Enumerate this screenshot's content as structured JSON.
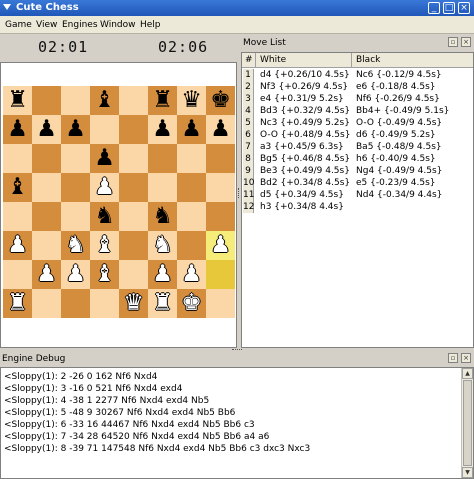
{
  "window": {
    "title": "Cute Chess",
    "buttons": {
      "minimize": "_",
      "maximize": "□",
      "close": "×"
    }
  },
  "menu": [
    "Game",
    "View",
    "Engines",
    "Window",
    "Help"
  ],
  "clocks": {
    "white": "02:01",
    "black": "02:06"
  },
  "board": {
    "ranks": [
      [
        "r",
        "",
        "",
        "b",
        "",
        "r",
        "q",
        "k"
      ],
      [
        "p",
        "p",
        "p",
        "",
        "",
        "p",
        "p",
        "p"
      ],
      [
        "",
        "",
        "",
        "p",
        "",
        "",
        "",
        ""
      ],
      [
        "b",
        "",
        "",
        "P",
        "",
        "",
        "",
        ""
      ],
      [
        "",
        "",
        "",
        "n",
        "",
        "n",
        "",
        ""
      ],
      [
        "P",
        "",
        "N",
        "B",
        "",
        "N",
        "",
        "P"
      ],
      [
        "",
        "P",
        "P",
        "B",
        "",
        "P",
        "P",
        ""
      ],
      [
        "R",
        "",
        "",
        "",
        "Q",
        "R",
        "K",
        ""
      ]
    ],
    "highlight": [
      "h3",
      "h2"
    ],
    "colors": {
      "light": "#fbd6a6",
      "dark": "#d48d3c",
      "highlight": "#e7c83a"
    }
  },
  "move_list": {
    "title": "Move List",
    "headers": {
      "num": "#",
      "white": "White",
      "black": "Black"
    },
    "rows": [
      {
        "n": "1",
        "white": "d4 {+0.26/10 4.5s}",
        "black": "Nc6 {-0.12/9 4.5s}"
      },
      {
        "n": "2",
        "white": "Nf3 {+0.26/9 4.5s}",
        "black": "e6 {-0.18/8 4.5s}"
      },
      {
        "n": "3",
        "white": "e4 {+0.31/9 5.2s}",
        "black": "Nf6 {-0.26/9 4.5s}"
      },
      {
        "n": "4",
        "white": "Bd3 {+0.32/9 4.5s}",
        "black": "Bb4+ {-0.49/9 5.1s}"
      },
      {
        "n": "5",
        "white": "Nc3 {+0.49/9 5.2s}",
        "black": "O-O {-0.49/9 4.5s}"
      },
      {
        "n": "6",
        "white": "O-O {+0.48/9 4.5s}",
        "black": "d6 {-0.49/9 5.2s}"
      },
      {
        "n": "7",
        "white": "a3 {+0.45/9 6.3s}",
        "black": "Ba5 {-0.48/9 4.5s}"
      },
      {
        "n": "8",
        "white": "Bg5 {+0.46/8 4.5s}",
        "black": "h6 {-0.40/9 4.5s}"
      },
      {
        "n": "9",
        "white": "Be3 {+0.49/9 4.5s}",
        "black": "Ng4 {-0.49/9 4.5s}"
      },
      {
        "n": "10",
        "white": "Bd2 {+0.34/8 4.5s}",
        "black": "e5 {-0.23/9 4.5s}"
      },
      {
        "n": "11",
        "white": "d5 {+0.34/9 4.5s}",
        "black": "Nd4 {-0.34/9 4.4s}"
      },
      {
        "n": "12",
        "white": "h3 {+0.34/8 4.4s}",
        "black": ""
      }
    ]
  },
  "debug": {
    "title": "Engine Debug",
    "lines": [
      "<Sloppy(1): 2 -26 0 162 Nf6 Nxd4",
      "<Sloppy(1): 3 -16 0 521 Nf6 Nxd4 exd4",
      "<Sloppy(1): 4 -38 1 2277 Nf6 Nxd4 exd4 Nb5",
      "<Sloppy(1): 5 -48 9 30267 Nf6 Nxd4 exd4 Nb5 Bb6",
      "<Sloppy(1): 6 -33 16 44467 Nf6 Nxd4 exd4 Nb5 Bb6 c3",
      "<Sloppy(1): 7 -34 28 64520 Nf6 Nxd4 exd4 Nb5 Bb6 a4 a6",
      "<Sloppy(1): 8 -39 71 147548 Nf6 Nxd4 exd4 Nb5 Bb6 c3 dxc3 Nxc3"
    ]
  }
}
